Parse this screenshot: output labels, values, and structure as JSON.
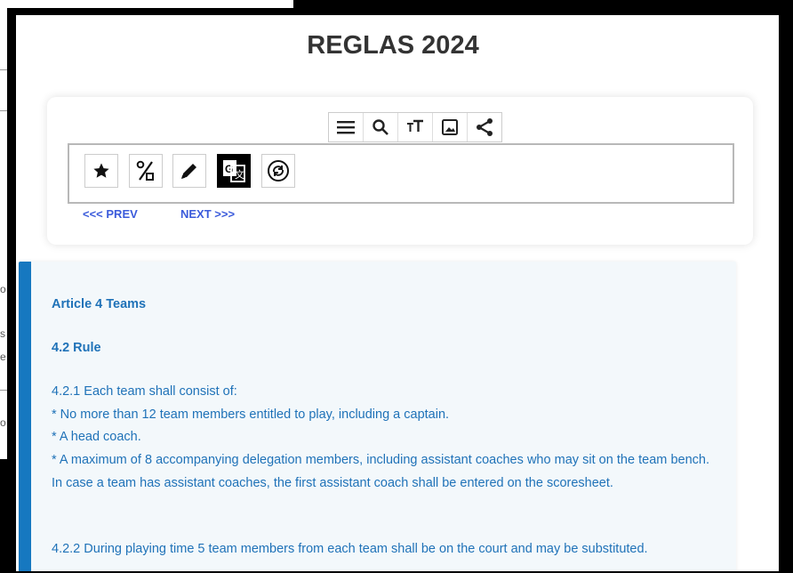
{
  "page": {
    "title": "REGLAS 2024"
  },
  "toolbar": {
    "icons": [
      "menu-icon",
      "search-icon",
      "text-size-icon",
      "image-icon",
      "share-icon"
    ]
  },
  "tools": {
    "icons": [
      "star-icon",
      "percent-icon",
      "pencil-icon",
      "translate-icon",
      "sync-icon"
    ],
    "active": "translate-icon"
  },
  "nav": {
    "prev_label": "<<< PREV",
    "next_label": "NEXT >>>"
  },
  "article": {
    "title": "Article 4 Teams",
    "subtitle": "4.2 Rule",
    "lines": [
      "4.2.1 Each team shall consist of:",
      "* No more than 12 team members entitled to play, including a captain.",
      "* A head coach.",
      "* A maximum of 8 accompanying delegation members, including assistant coaches who may sit on the team bench. In case a team has assistant coaches, the first assistant coach shall be entered on the scoresheet.",
      "4.2.2 During playing time 5 team members from each team shall be on the court and may be substituted."
    ]
  },
  "background_window": {
    "fragments": [
      "o",
      "s",
      "e",
      "o"
    ]
  },
  "colors": {
    "accent": "#1678c0",
    "link": "#3b5bdb",
    "text": "#1f72b8",
    "content_bg": "#f3f8fb"
  }
}
